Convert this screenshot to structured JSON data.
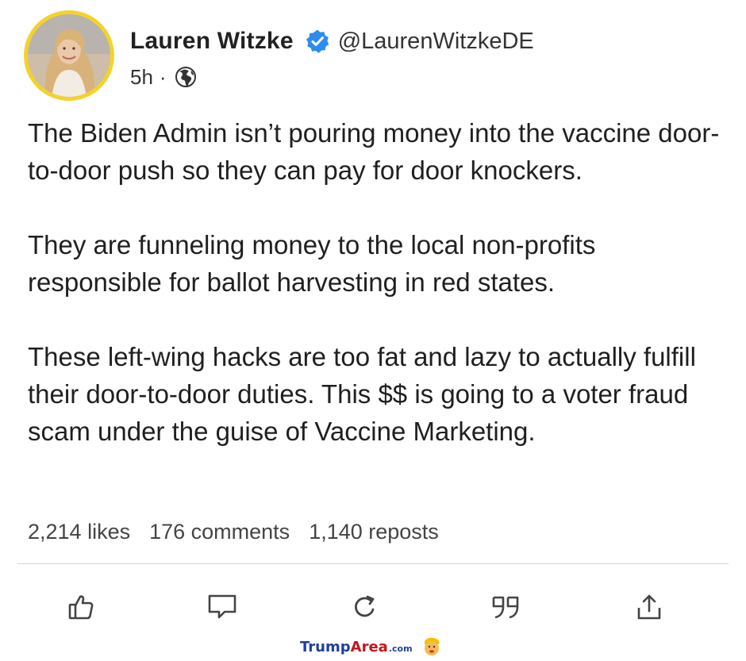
{
  "author": {
    "display_name": "Lauren Witzke",
    "handle": "@LaurenWitzkeDE",
    "verified_icon": "verified-badge-icon",
    "avatar_ring_color": "#f3d32b"
  },
  "meta": {
    "time_ago": "5h",
    "separator": "·",
    "visibility_icon": "globe-icon"
  },
  "post": {
    "paragraphs": [
      "The Biden Admin isn’t pouring money into the vaccine door-to-door push so they can pay for door knockers.",
      "They are funneling money to the local non-profits responsible for ballot harvesting in red states.",
      "These left-wing hacks are too fat and lazy to actually fulfill their door-to-door duties. This $$ is going to a voter fraud scam under the guise of Vaccine Marketing."
    ]
  },
  "stats": {
    "likes": "2,214 likes",
    "comments": "176 comments",
    "reposts": "1,140 reposts"
  },
  "actions": [
    {
      "name": "like",
      "icon": "thumbs-up-icon"
    },
    {
      "name": "comment",
      "icon": "comment-icon"
    },
    {
      "name": "repost",
      "icon": "repost-icon"
    },
    {
      "name": "quote",
      "icon": "quote-icon"
    },
    {
      "name": "share",
      "icon": "share-icon"
    }
  ],
  "watermark": {
    "trump": "Trump",
    "area": "Area",
    "com": ".com",
    "trump_color": "#1f3fa0",
    "area_color": "#c4161c"
  },
  "colors": {
    "verified_blue": "#2b8df0",
    "text": "#1f1f1f",
    "icon_gray": "#444444"
  }
}
